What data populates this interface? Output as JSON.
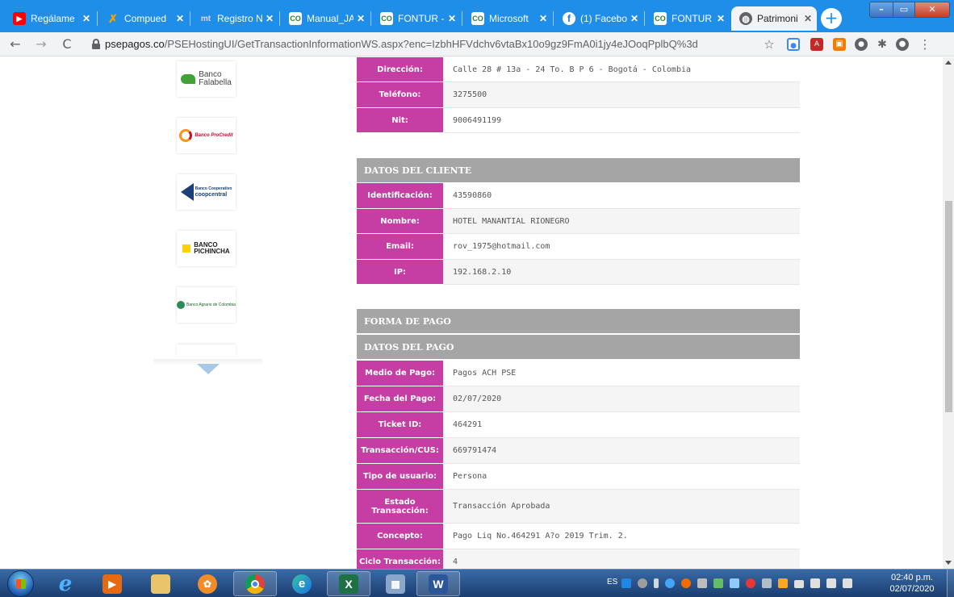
{
  "browser": {
    "tabs": [
      {
        "title": "Regálame",
        "favicon": "youtube-icon",
        "color": "#ff0000",
        "glyph": "▶"
      },
      {
        "title": "Compued",
        "favicon": "compuedu-icon",
        "color": "#f4a300",
        "glyph": "✓"
      },
      {
        "title": "Registro N",
        "favicon": "mt-icon",
        "color": "#7a3b8f",
        "glyph": "mt"
      },
      {
        "title": "Manual_JA",
        "favicon": "fontur-icon",
        "color": "#2e7d32",
        "glyph": "CO"
      },
      {
        "title": "FONTUR -",
        "favicon": "fontur-icon",
        "color": "#2e7d32",
        "glyph": "CO"
      },
      {
        "title": "Microsoft",
        "favicon": "fontur-icon",
        "color": "#2e7d32",
        "glyph": "CO"
      },
      {
        "title": "(1) Facebo",
        "favicon": "facebook-icon",
        "color": "#1877f2",
        "glyph": "f"
      },
      {
        "title": "FONTUR -",
        "favicon": "fontur-icon",
        "color": "#2e7d32",
        "glyph": "CO"
      },
      {
        "title": "Patrimoni",
        "favicon": "globe-icon",
        "color": "#5f6368",
        "glyph": "◍"
      }
    ],
    "url_host": "psepagos.co",
    "url_path": "/PSEHostingUI/GetTransactionInformationWS.aspx?enc=IzbhHFVdchv6vtaBx10o9gz9FmA0i1jy4eJOoqPplbQ%3d"
  },
  "banks": [
    {
      "name": "Banco Falabella",
      "line1": "Banco",
      "line2": "Falabella"
    },
    {
      "name": "Banco ProCredit",
      "line1": "Banco ProCredit",
      "line2": ""
    },
    {
      "name": "Banco Cooperativo Coopcentral",
      "line1": "Banco Cooperativo",
      "line2": "coopcentral"
    },
    {
      "name": "Banco Pichincha",
      "line1": "BANCO",
      "line2": "PICHINCHA"
    },
    {
      "name": "Banco Agrario de Colombia",
      "line1": "Banco Agrario de Colombia",
      "line2": ""
    }
  ],
  "company": {
    "direccion_label": "Dirección:",
    "direccion": "Calle 28 # 13a - 24 To. B P 6 - Bogotá - Colombia",
    "telefono_label": "Teléfono:",
    "telefono": "3275500",
    "nit_label": "Nit:",
    "nit": "9006491199"
  },
  "client": {
    "title": "DATOS DEL CLIENTE",
    "id_label": "Identificación:",
    "id": "43590860",
    "nombre_label": "Nombre:",
    "nombre": "HOTEL MANANTIAL RIONEGRO",
    "email_label": "Email:",
    "email": "rov_1975@hotmail.com",
    "ip_label": "IP:",
    "ip": "192.168.2.10"
  },
  "payment": {
    "forma_title": "FORMA DE PAGO",
    "datos_title": "DATOS DEL PAGO",
    "medio_label": "Medio de Pago:",
    "medio": "Pagos ACH PSE",
    "fecha_label": "Fecha del Pago:",
    "fecha": "02/07/2020",
    "ticket_label": "Ticket ID:",
    "ticket": "464291",
    "cus_label": "Transacción/CUS:",
    "cus": "669791474",
    "tipo_label": "Tipo de usuario:",
    "tipo": "Persona",
    "estado_label": "Estado Transacción:",
    "estado": "Transacción Aprobada",
    "concepto_label": "Concepto:",
    "concepto": "Pago Liq No.464291 A?o 2019 Trim. 2.",
    "ciclo_label": "Ciclo Transacción:",
    "ciclo": "4"
  },
  "taskbar": {
    "lang": "ES",
    "time": "02:40 p.m.",
    "date": "02/07/2020"
  },
  "colors": {
    "label_magenta": "#c63ea3",
    "section_gray": "#a5a5a5",
    "tabstrip_blue": "#1f8ee9"
  }
}
